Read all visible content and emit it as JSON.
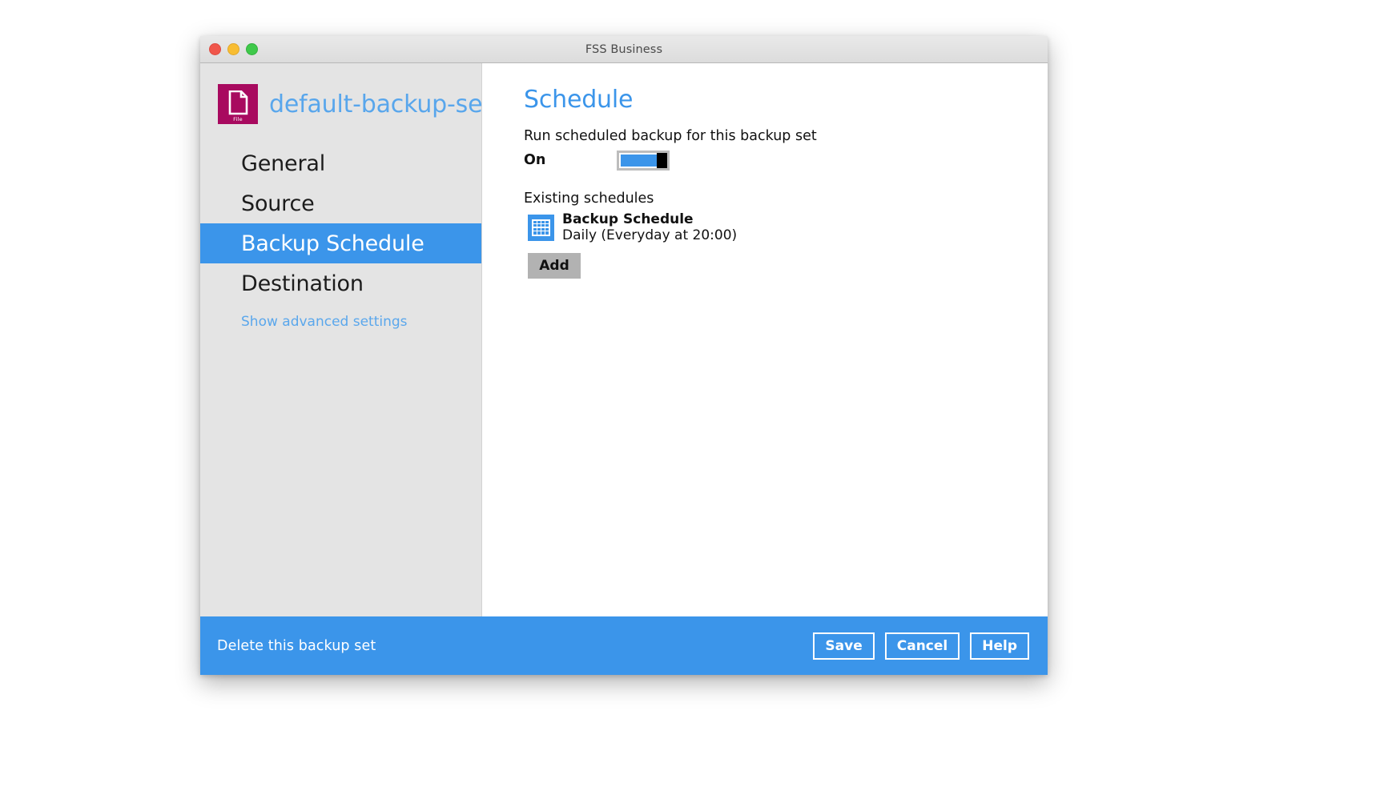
{
  "window": {
    "title": "FSS Business",
    "traffic_lights": [
      "close",
      "minimize",
      "maximize"
    ]
  },
  "sidebar": {
    "backup_set": {
      "icon_label": "File",
      "icon_name": "file-document-icon",
      "icon_color": "#a80a5f",
      "name": "default-backup-se..."
    },
    "items": [
      {
        "label": "General",
        "active": false
      },
      {
        "label": "Source",
        "active": false
      },
      {
        "label": "Backup Schedule",
        "active": true
      },
      {
        "label": "Destination",
        "active": false
      }
    ],
    "advanced_link": "Show advanced settings"
  },
  "main": {
    "title": "Schedule",
    "run_scheduled_label": "Run scheduled backup for this backup set",
    "toggle": {
      "state_label": "On",
      "on": true
    },
    "existing_schedules_label": "Existing schedules",
    "schedules": [
      {
        "icon_name": "calendar-grid-icon",
        "name": "Backup Schedule",
        "description": "Daily (Everyday at 20:00)"
      }
    ],
    "add_button_label": "Add"
  },
  "footer": {
    "delete_label": "Delete this backup set",
    "buttons": [
      {
        "label": "Save"
      },
      {
        "label": "Cancel"
      },
      {
        "label": "Help"
      }
    ]
  },
  "colors": {
    "accent_blue": "#3b95ea",
    "link_blue": "#5aa7ec",
    "sidebar_gray": "#e4e4e4",
    "file_icon_magenta": "#a80a5f",
    "add_button_gray": "#b2b2b2"
  }
}
